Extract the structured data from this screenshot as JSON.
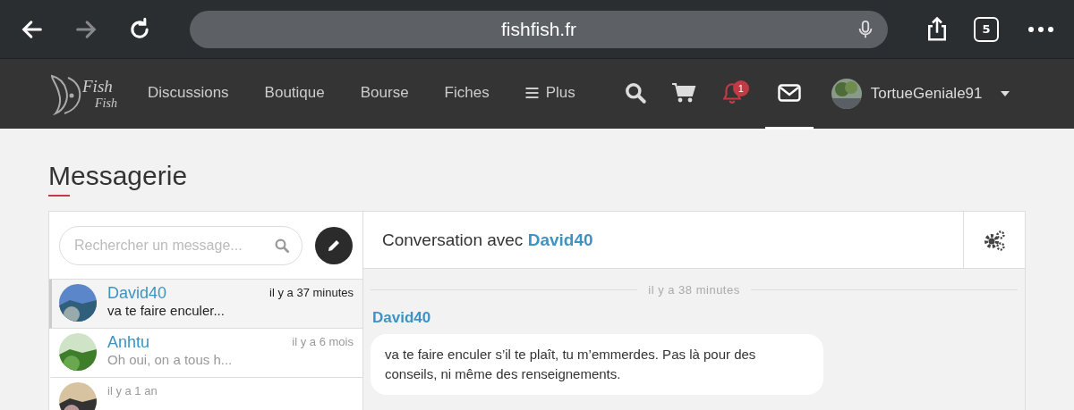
{
  "browser": {
    "url": "fishfish.fr",
    "tab_count": "5"
  },
  "nav": {
    "logo_top": "Fish",
    "logo_bottom": "Fish",
    "items": [
      {
        "label": "Discussions",
        "kind": "text",
        "selected": false
      },
      {
        "label": "Boutique",
        "kind": "text",
        "selected": false
      },
      {
        "label": "Bourse",
        "kind": "text",
        "selected": false
      },
      {
        "label": "Fiches",
        "kind": "text",
        "selected": false
      },
      {
        "label": "Plus",
        "kind": "menu",
        "selected": false
      },
      {
        "kind": "search",
        "selected": false
      },
      {
        "kind": "cart",
        "selected": false
      },
      {
        "kind": "bell",
        "badge": "1",
        "selected": false
      },
      {
        "kind": "mail",
        "selected": true
      }
    ],
    "user": {
      "name": "TortueGeniale91"
    }
  },
  "page_title": "Messagerie",
  "search": {
    "placeholder": "Rechercher un message..."
  },
  "conversations": [
    {
      "name": "David40",
      "time": "il y a 37 minutes",
      "preview": "va te faire enculer...",
      "selected": true,
      "unread": true
    },
    {
      "name": "Anhtu",
      "time": "il y a 6 mois",
      "preview": "Oh oui, on a tous h...",
      "selected": false,
      "unread": false
    },
    {
      "time": "il y a 1 an",
      "selected": false,
      "unread": false
    }
  ],
  "conversation": {
    "title_prefix": "Conversation avec",
    "partner": "David40",
    "messages": [
      {
        "separator": "il y a 38 minutes",
        "author": "David40",
        "text": "va te faire enculer s’il te plaît, tu m’emmerdes. Pas là pour des conseils, ni même des renseignements."
      }
    ]
  }
}
